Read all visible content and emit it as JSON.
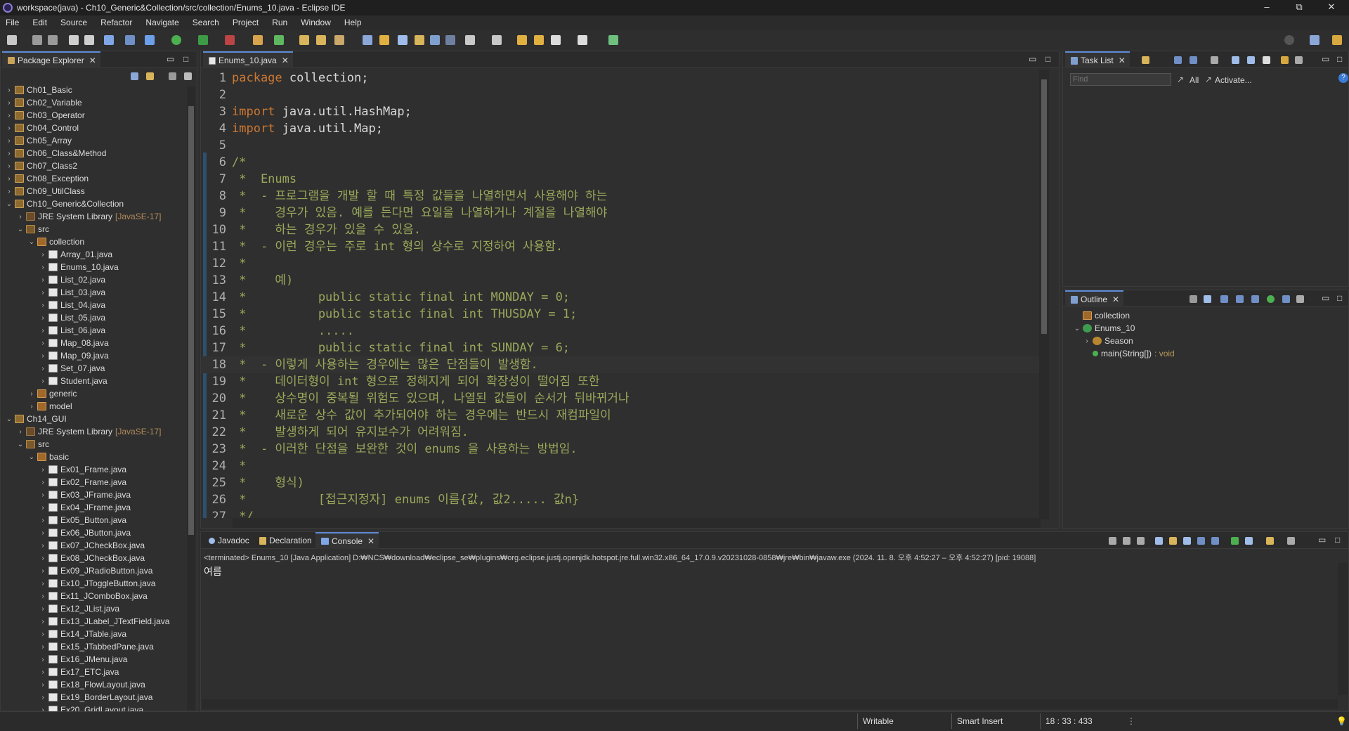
{
  "window": {
    "title": "workspace(java) - Ch10_Generic&Collection/src/collection/Enums_10.java - Eclipse IDE",
    "minimize": "–",
    "restore": "⧉",
    "close": "✕"
  },
  "menubar": [
    "File",
    "Edit",
    "Source",
    "Refactor",
    "Navigate",
    "Search",
    "Project",
    "Run",
    "Window",
    "Help"
  ],
  "package_explorer": {
    "tab_label": "Package Explorer",
    "items": [
      {
        "label": "Ch01_Basic"
      },
      {
        "label": "Ch02_Variable"
      },
      {
        "label": "Ch03_Operator"
      },
      {
        "label": "Ch04_Control"
      },
      {
        "label": "Ch05_Array"
      },
      {
        "label": "Ch06_Class&Method"
      },
      {
        "label": "Ch07_Class2"
      },
      {
        "label": "Ch08_Exception"
      },
      {
        "label": "Ch09_UtilClass"
      },
      {
        "label": "Ch10_Generic&Collection"
      },
      {
        "label": "JRE System Library",
        "decor": "[JavaSE-17]"
      },
      {
        "label": "src"
      },
      {
        "label": "collection"
      },
      {
        "label": "Array_01.java"
      },
      {
        "label": "Enums_10.java"
      },
      {
        "label": "List_02.java"
      },
      {
        "label": "List_03.java"
      },
      {
        "label": "List_04.java"
      },
      {
        "label": "List_05.java"
      },
      {
        "label": "List_06.java"
      },
      {
        "label": "Map_08.java"
      },
      {
        "label": "Map_09.java"
      },
      {
        "label": "Set_07.java"
      },
      {
        "label": "Student.java"
      },
      {
        "label": "generic"
      },
      {
        "label": "model"
      },
      {
        "label": "Ch14_GUI"
      },
      {
        "label": "JRE System Library",
        "decor": "[JavaSE-17]"
      },
      {
        "label": "src"
      },
      {
        "label": "basic"
      },
      {
        "label": "Ex01_Frame.java"
      },
      {
        "label": "Ex02_Frame.java"
      },
      {
        "label": "Ex03_JFrame.java"
      },
      {
        "label": "Ex04_JFrame.java"
      },
      {
        "label": "Ex05_Button.java"
      },
      {
        "label": "Ex06_JButton.java"
      },
      {
        "label": "Ex07_JCheckBox.java"
      },
      {
        "label": "Ex08_JCheckBox.java"
      },
      {
        "label": "Ex09_JRadioButton.java"
      },
      {
        "label": "Ex10_JToggleButton.java"
      },
      {
        "label": "Ex11_JComboBox.java"
      },
      {
        "label": "Ex12_JList.java"
      },
      {
        "label": "Ex13_JLabel_JTextField.java"
      },
      {
        "label": "Ex14_JTable.java"
      },
      {
        "label": "Ex15_JTabbedPane.java"
      },
      {
        "label": "Ex16_JMenu.java"
      },
      {
        "label": "Ex17_ETC.java"
      },
      {
        "label": "Ex18_FlowLayout.java"
      },
      {
        "label": "Ex19_BorderLayout.java"
      },
      {
        "label": "Ex20_GridLayout.java"
      }
    ]
  },
  "editor": {
    "tab_label": "Enums_10.java",
    "lines": [
      {
        "n": "1",
        "text": "package collection;"
      },
      {
        "n": "2",
        "text": ""
      },
      {
        "n": "3",
        "text": "import java.util.HashMap;"
      },
      {
        "n": "4",
        "text": "import java.util.Map;"
      },
      {
        "n": "5",
        "text": ""
      },
      {
        "n": "6",
        "text": "/*"
      },
      {
        "n": "7",
        "text": " *  Enums"
      },
      {
        "n": "8",
        "text": " *  - 프로그램을 개발 할 때 특정 값들을 나열하면서 사용해야 하는"
      },
      {
        "n": "9",
        "text": " *    경우가 있음. 예를 든다면 요일을 나열하거나 계절을 나열해야"
      },
      {
        "n": "10",
        "text": " *    하는 경우가 있을 수 있음."
      },
      {
        "n": "11",
        "text": " *  - 이런 경우는 주로 int 형의 상수로 지정하여 사용함."
      },
      {
        "n": "12",
        "text": " *"
      },
      {
        "n": "13",
        "text": " *    예)"
      },
      {
        "n": "14",
        "text": " *          public static final int MONDAY = 0;"
      },
      {
        "n": "15",
        "text": " *          public static final int THUSDAY = 1;"
      },
      {
        "n": "16",
        "text": " *          ....."
      },
      {
        "n": "17",
        "text": " *          public static final int SUNDAY = 6;"
      },
      {
        "n": "18",
        "text": " *  - 이렇게 사용하는 경우에는 많은 단점들이 발생함."
      },
      {
        "n": "19",
        "text": " *    데이터형이 int 형으로 정해지게 되어 확장성이 떨어짐 또한"
      },
      {
        "n": "20",
        "text": " *    상수명이 중복될 위험도 있으며, 나열된 값들이 순서가 뒤바뀌거나"
      },
      {
        "n": "21",
        "text": " *    새로운 상수 값이 추가되어야 하는 경우에는 반드시 재컴파일이"
      },
      {
        "n": "22",
        "text": " *    발생하게 되어 유지보수가 어려워짐."
      },
      {
        "n": "23",
        "text": " *  - 이러한 단점을 보완한 것이 enums 을 사용하는 방법임."
      },
      {
        "n": "24",
        "text": " *"
      },
      {
        "n": "25",
        "text": " *    형식)"
      },
      {
        "n": "26",
        "text": " *          [접근지정자] enums 이름{값, 값2..... 값n}"
      },
      {
        "n": "27",
        "text": " */"
      }
    ]
  },
  "task_list": {
    "tab_label": "Task List",
    "find_placeholder": "Find",
    "all_label": "All",
    "activate_label": "Activate..."
  },
  "outline": {
    "tab_label": "Outline",
    "items": [
      {
        "label": "collection"
      },
      {
        "label": "Enums_10"
      },
      {
        "label": "Season"
      },
      {
        "label": "main(String[])",
        "decor": ": void"
      }
    ]
  },
  "bottom": {
    "tabs": [
      "Javadoc",
      "Declaration",
      "Console"
    ],
    "console_header": "<terminated> Enums_10 [Java Application] D:₩NCS₩download₩eclipse_se₩plugins₩org.eclipse.justj.openjdk.hotspot.jre.full.win32.x86_64_17.0.9.v20231028-0858₩jre₩bin₩javaw.exe  (2024. 11. 8. 오후 4:52:27 – 오후 4:52:27) [pid: 19088]",
    "console_output": "여름"
  },
  "status": {
    "writable": "Writable",
    "insert_mode": "Smart Insert",
    "position": "18 : 33 : 433"
  }
}
